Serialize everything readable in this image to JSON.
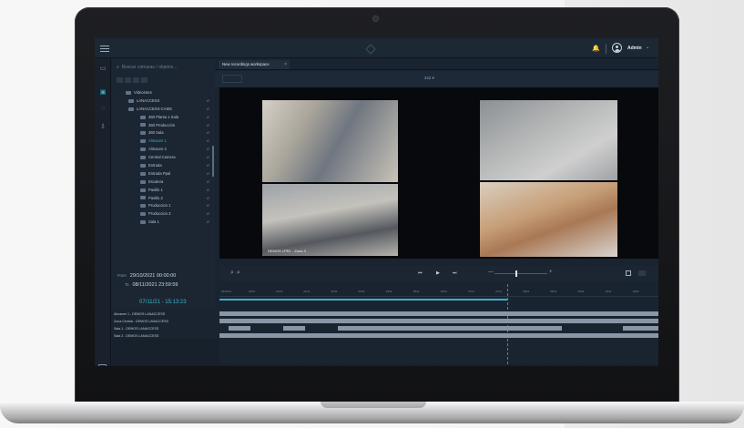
{
  "topbar": {
    "user": "Admin"
  },
  "side": {
    "search_placeholder": "Buscar cámaras / objetos...",
    "tree": [
      {
        "label": "Videostore",
        "level": 0
      },
      {
        "label": "LANACCESS",
        "level": 1
      },
      {
        "label": "LANACCESS-CAMS",
        "level": 1
      },
      {
        "label": "360 Planta 1 Sala",
        "level": 2
      },
      {
        "label": "360 Producción",
        "level": 2
      },
      {
        "label": "360 Sala",
        "level": 2
      },
      {
        "label": "Almacen 1",
        "level": 2,
        "selected": true
      },
      {
        "label": "Almacen 2",
        "level": 2
      },
      {
        "label": "Central Camera",
        "level": 2
      },
      {
        "label": "Entrada",
        "level": 2
      },
      {
        "label": "Entrada Ppal",
        "level": 2
      },
      {
        "label": "Escalera",
        "level": 2
      },
      {
        "label": "Pasillo 1",
        "level": 2
      },
      {
        "label": "Pasillo 2",
        "level": 2
      },
      {
        "label": "Produccion 1",
        "level": 2
      },
      {
        "label": "Produccion 3",
        "level": 2
      },
      {
        "label": "Sala 1",
        "level": 2
      }
    ]
  },
  "tab": {
    "label": "New recordings workspace"
  },
  "toolbar": {
    "layout_label": "2x2 ▾"
  },
  "cameras": [
    {
      "label": ""
    },
    {
      "label": "DEMOS LPR1 - Zona 3"
    },
    {
      "label": ""
    },
    {
      "label": ""
    }
  ],
  "dates": {
    "from_label": "From",
    "from_value": "29/10/2021  00:00:00",
    "to_label": "To",
    "to_value": "08/11/2021  23:59:59",
    "current": "07/11/21 - 15:13:23"
  },
  "playback": {
    "prev": "⏮",
    "play": "▶",
    "next": "⏭",
    "minus": "—",
    "plus": "+"
  },
  "timeline": {
    "ticks": [
      "29/10/21",
      "30/10",
      "31/10",
      "01/11",
      "02/11",
      "03/11",
      "04/11",
      "05/11",
      "06/11",
      "07/11",
      "07/11",
      "08/11",
      "08/11",
      "09/11",
      "09/11",
      "10/11"
    ],
    "progress": 0.655,
    "tracks": [
      {
        "label": "Almacen 1 - DEMOS LANACCESS",
        "segments": [
          [
            0,
            1
          ]
        ]
      },
      {
        "label": "Zona Central - DEMOS LANACCESS",
        "segments": [
          [
            0,
            1
          ]
        ]
      },
      {
        "label": "Sala 1 - DEMOS LANACCESS",
        "segments": [
          [
            0.02,
            0.07
          ],
          [
            0.145,
            0.195
          ],
          [
            0.27,
            0.78
          ],
          [
            0.92,
            1
          ]
        ]
      },
      {
        "label": "Sala 2 - DEMOS LANACCESS",
        "segments": [
          [
            0,
            1
          ]
        ]
      }
    ]
  }
}
